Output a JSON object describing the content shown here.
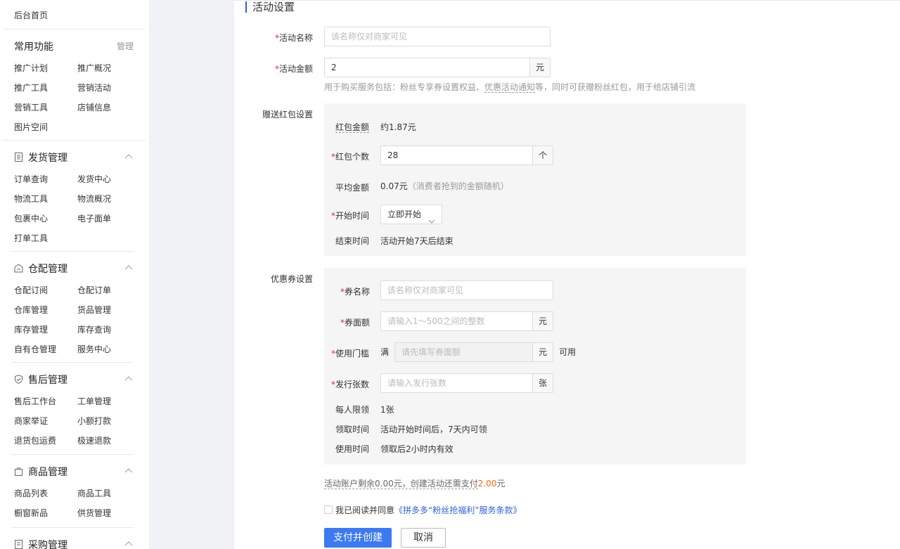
{
  "sidebar": {
    "home": "后台首页",
    "common": {
      "title": "常用功能",
      "manage": "管理",
      "items": [
        "推广计划",
        "推广概况",
        "推广工具",
        "营销活动",
        "营销工具",
        "店铺信息",
        "图片空间"
      ]
    },
    "shipping": {
      "title": "发货管理",
      "items": [
        "订单查询",
        "发货中心",
        "物流工具",
        "物流概况",
        "包裹中心",
        "电子面单",
        "打单工具"
      ]
    },
    "warehouse": {
      "title": "仓配管理",
      "items": [
        "仓配订阅",
        "仓配订单",
        "仓库管理",
        "货品管理",
        "库存管理",
        "库存查询",
        "自有仓管理",
        "服务中心"
      ]
    },
    "aftersale": {
      "title": "售后管理",
      "items": [
        "售后工作台",
        "工单管理",
        "商家举证",
        "小额打款",
        "退货包运费",
        "极速退款"
      ]
    },
    "goods": {
      "title": "商品管理",
      "items": [
        "商品列表",
        "商品工具",
        "橱窗新品",
        "供货管理"
      ]
    },
    "purchase": {
      "title": "采购管理"
    }
  },
  "form": {
    "section_title": "活动设置",
    "activity_name": {
      "label": "活动名称",
      "placeholder": "该名称仅对商家可见",
      "value": ""
    },
    "activity_amount": {
      "label": "活动金额",
      "value": "2",
      "unit": "元",
      "hint_prefix": "用于购买服务包括：粉丝专享券设置权益、",
      "hint_link": "优惠活动通知",
      "hint_suffix": "等，同时可获赠粉丝红包，用于给店铺引流"
    },
    "redpacket": {
      "label": "赠送红包设置",
      "amount_label": "红包金额",
      "amount_value": "约1.87元",
      "count_label": "红包个数",
      "count_value": "28",
      "count_unit": "个",
      "avg_label": "平均金额",
      "avg_value": "0.07元",
      "avg_note": "（消费者抢到的金额随机）",
      "start_label": "开始时间",
      "start_value": "立即开始",
      "end_label": "结束时间",
      "end_value": "活动开始7天后结束"
    },
    "coupon": {
      "label": "优惠券设置",
      "name_label": "券名称",
      "name_placeholder": "该名称仅对商家可见",
      "face_label": "券面额",
      "face_placeholder": "请输入1～500之间的整数",
      "face_unit": "元",
      "threshold_label": "使用门槛",
      "threshold_prefix": "满",
      "threshold_placeholder": "请先填写券面额",
      "threshold_unit": "元",
      "threshold_suffix": "可用",
      "issue_label": "发行张数",
      "issue_placeholder": "请输入发行张数",
      "issue_unit": "张",
      "limit_label": "每人限领",
      "limit_value": "1张",
      "receive_label": "领取时间",
      "receive_value": "活动开始时间后，7天内可领",
      "use_label": "使用时间",
      "use_value": "领取后2小时内有效"
    },
    "balance": {
      "prefix": "活动账户剩余0.00元，创建活动还需支付",
      "amount": "2.00",
      "suffix": "元"
    },
    "agreement": {
      "text": "我已阅读并同意",
      "link": "《拼多多“粉丝抢福利”服务条款》"
    },
    "buttons": {
      "submit": "支付并创建",
      "cancel": "取消"
    }
  },
  "colors": {
    "accent_blue": "#3b7af5",
    "link_blue": "#2d5ee5",
    "required_red": "#e02e24",
    "price_orange": "#ff6600"
  }
}
